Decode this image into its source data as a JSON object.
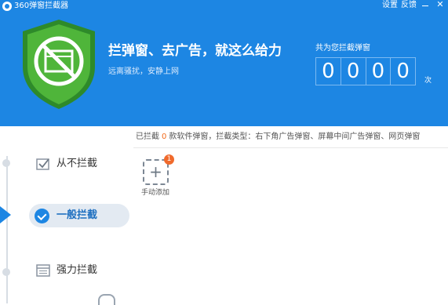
{
  "app": {
    "title": "360弹窗拦截器"
  },
  "titlebar": {
    "settings": "设置",
    "feedback": "反馈",
    "close": "✕"
  },
  "hero": {
    "headline": "拦弹窗、去广告，就这么给力",
    "subline": "远离骚扰，安静上网"
  },
  "counter": {
    "label": "共为您拦截弹窗",
    "digits": [
      "0",
      "0",
      "0",
      "0"
    ],
    "unit": "次"
  },
  "modes": [
    {
      "label": "从不拦截",
      "icon": "checkbox-icon",
      "selected": false
    },
    {
      "label": "一般拦截",
      "icon": "check-circle-icon",
      "selected": true
    },
    {
      "label": "强力拦截",
      "icon": "window-icon",
      "selected": false
    }
  ],
  "summary": {
    "prefix": "已拦截",
    "count": "0",
    "suffix": "款软件弹窗，拦截类型：右下角广告弹窗、屏幕中间广告弹窗、网页弹窗"
  },
  "add": {
    "label": "手动添加",
    "badge": "1",
    "icon": "plus-icon"
  },
  "colors": {
    "accent": "#1d86e3",
    "shield_green": "#4fb53a",
    "badge": "#f06a2c"
  }
}
